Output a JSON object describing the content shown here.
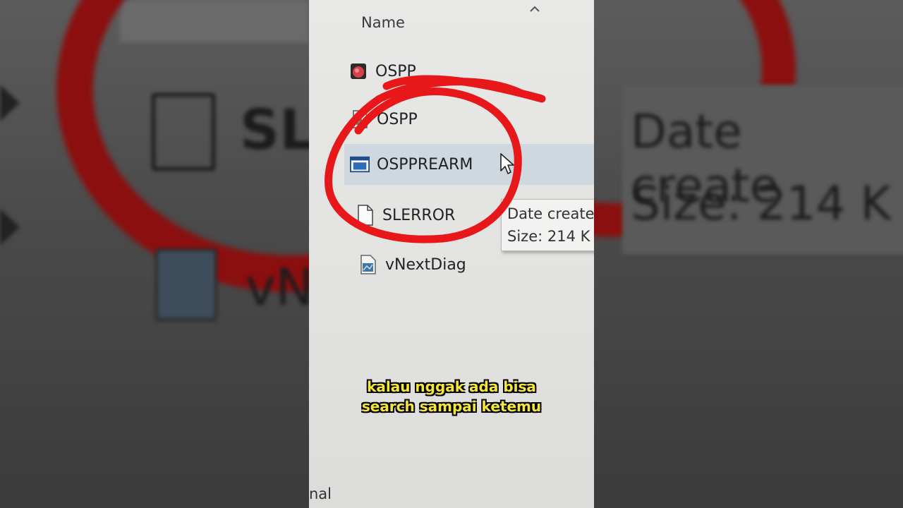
{
  "explorer": {
    "column_header": "Name",
    "sort_icon": "chevron-up-icon",
    "files": [
      {
        "name": "OSPP",
        "icon": "app-icon-red"
      },
      {
        "name": "OSPP",
        "icon": "script-file-icon"
      },
      {
        "name": "OSPPREARM",
        "icon": "executable-window-icon",
        "selected": true
      },
      {
        "name": "SLERROR",
        "icon": "blank-document-icon"
      },
      {
        "name": "vNextDiag",
        "icon": "image-file-icon"
      }
    ],
    "tooltip": {
      "line1": "Date create",
      "line2": "Size: 214 K"
    },
    "bottom_fragment": "nal"
  },
  "background_blur": {
    "left_text_1": "SLE",
    "left_text_2": "vN",
    "right_text_1": "Date create",
    "right_text_2": "Size: 214 K"
  },
  "caption": {
    "line1": "kalau nggak ada bisa",
    "line2": "search sampai ketemu"
  },
  "colors": {
    "annotation_circle": "#e8181a",
    "caption_text": "#f7e63a",
    "selection": "#cfd7df"
  }
}
